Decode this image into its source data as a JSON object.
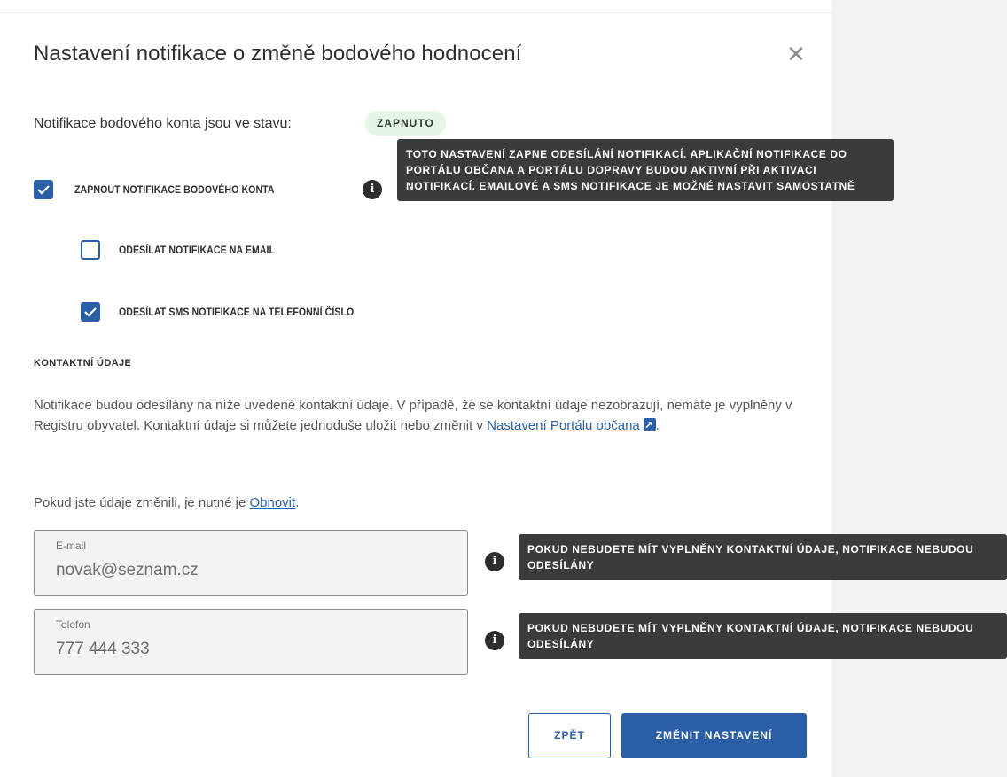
{
  "dialog": {
    "title": "Nastavení notifikace o změně bodového hodnocení",
    "close_icon": "close-icon"
  },
  "status": {
    "label": "Notifikace bodového konta jsou ve stavu:",
    "badge": "ZAPNUTO",
    "badge_color": "#e6f6e6"
  },
  "options": {
    "main": {
      "label": "ZAPNOUT NOTIFIKACE BODOVÉHO KONTA",
      "checked": true
    },
    "email": {
      "label": "ODESÍLAT NOTIFIKACE NA EMAIL",
      "checked": false
    },
    "sms": {
      "label": "ODESÍLAT SMS NOTIFIKACE NA TELEFONNÍ ČÍSLO",
      "checked": true
    }
  },
  "tooltips": {
    "main": "TOTO NASTAVENÍ ZAPNE ODESÍLÁNÍ NOTIFIKACÍ. APLIKAČNÍ NOTIFIKACE DO PORTÁLU OBČANA A PORTÁLU DOPRAVY BUDOU AKTIVNÍ PŘI AKTIVACI NOTIFIKACÍ. EMAILOVÉ A SMS NOTIFIKACE JE MOŽNÉ NASTAVIT SAMOSTATNĚ",
    "email": "POKUD NEBUDETE MÍT VYPLNĚNY KONTAKTNÍ ÚDAJE, NOTIFIKACE NEBUDOU ODESÍLÁNY",
    "phone": "POKUD NEBUDETE MÍT VYPLNĚNY KONTAKTNÍ ÚDAJE, NOTIFIKACE NEBUDOU ODESÍLÁNY"
  },
  "contact": {
    "heading": "KONTAKTNÍ ÚDAJE",
    "para_text": "Notifikace budou odesílány na níže uvedené kontaktní údaje. V případě, že se kontaktní údaje nezobrazují, nemáte je vyplněny v Registru obyvatel. Kontaktní údaje si můžete jednoduše uložit nebo změnit v ",
    "para_link": "Nastavení Portálu občana",
    "para_end": ".",
    "refresh_text": "Pokud jste údaje změnili, je nutné je ",
    "refresh_link": "Obnovit",
    "refresh_end": "."
  },
  "fields": {
    "email": {
      "label": "E-mail",
      "value": "novak@seznam.cz"
    },
    "phone": {
      "label": "Telefon",
      "value": "777 444 333"
    }
  },
  "buttons": {
    "back": "ZPĚT",
    "save": "ZMĚNIT NASTAVENÍ"
  },
  "colors": {
    "accent": "#2a5fa7",
    "tooltip_bg": "#3b3b3b"
  }
}
